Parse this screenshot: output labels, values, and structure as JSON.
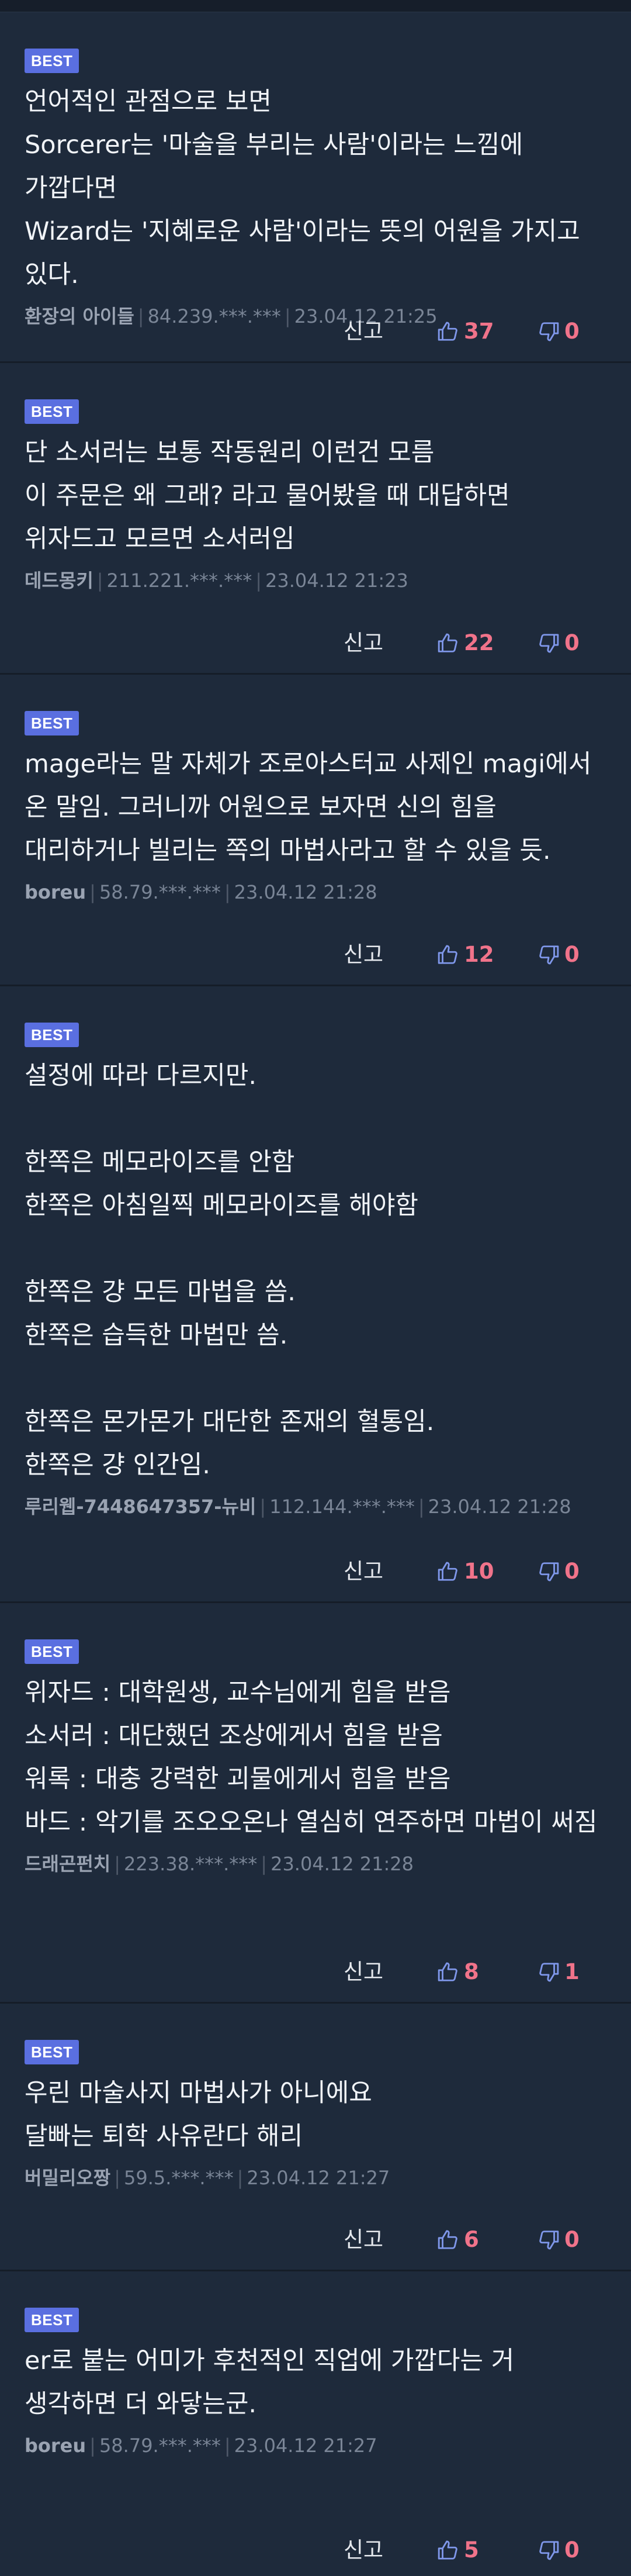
{
  "labels": {
    "best": "BEST",
    "report": "신고"
  },
  "colors": {
    "background": "#1e2a3b",
    "best_badge": "#5a6fe0",
    "vote_count": "#f0738a",
    "icon": "#7f97ea"
  },
  "comments": [
    {
      "text": "언어적인 관점으로 보면\nSorcerer는 '마술을 부리는 사람'이라는 느낌에 가깝다면\nWizard는 '지혜로운 사람'이라는 뜻의 어원을 가지고 있다.",
      "author": "환장의 아이들",
      "ip": "84.239.***.***",
      "date": "23.04.12 21:25",
      "up": "37",
      "down": "0"
    },
    {
      "text": "단 소서러는 보통 작동원리 이런건 모름\n이 주문은 왜 그래? 라고 물어봤을 때 대답하면 위자드고 모르면 소서러임",
      "author": "데드몽키",
      "ip": "211.221.***.***",
      "date": "23.04.12 21:23",
      "up": "22",
      "down": "0"
    },
    {
      "text": "mage라는 말 자체가 조로아스터교 사제인 magi에서 온 말임. 그러니까 어원으로 보자면 신의 힘을 대리하거나 빌리는 쪽의 마법사라고 할 수 있을 듯.",
      "author": "boreu",
      "ip": "58.79.***.***",
      "date": "23.04.12 21:28",
      "up": "12",
      "down": "0"
    },
    {
      "text": "설정에 따라 다르지만.\n\n한쪽은 메모라이즈를 안함\n한쪽은 아침일찍 메모라이즈를 해야함\n\n한쪽은 걍 모든 마법을 씀.\n한쪽은 습득한 마법만 씀.\n\n한쪽은 몬가몬가 대단한 존재의 혈통임.\n한쪽은 걍 인간임.",
      "author": "루리웹-7448647357-뉴비",
      "ip": "112.144.***.***",
      "date": "23.04.12 21:28",
      "up": "10",
      "down": "0"
    },
    {
      "text": "위자드 : 대학원생, 교수님에게 힘을 받음\n소서러 : 대단했던 조상에게서 힘을 받음\n워록 : 대충 강력한 괴물에게서 힘을 받음\n바드 : 악기를 조오오온나 열심히 연주하면 마법이 써짐",
      "author": "드래곤펀치",
      "ip": "223.38.***.***",
      "date": "23.04.12 21:28",
      "up": "8",
      "down": "1"
    },
    {
      "text": "우린 마술사지 마법사가 아니에요\n달빠는 퇴학 사유란다 해리",
      "author": "버밀리오짱",
      "ip": "59.5.***.***",
      "date": "23.04.12 21:27",
      "up": "6",
      "down": "0"
    },
    {
      "text": "er로 붙는 어미가 후천적인 직업에 가깝다는 거 생각하면 더 와닿는군.",
      "author": "boreu",
      "ip": "58.79.***.***",
      "date": "23.04.12 21:27",
      "up": "5",
      "down": "0"
    }
  ]
}
